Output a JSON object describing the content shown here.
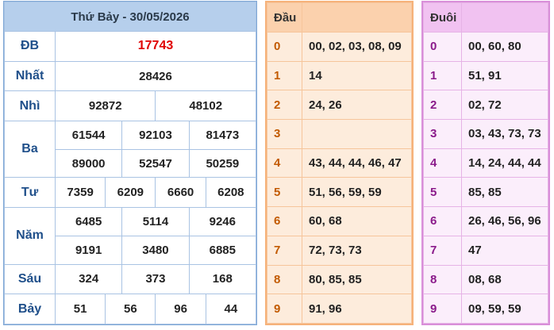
{
  "results": {
    "title": "Thứ Bảy - 30/05/2026",
    "rows": {
      "db": {
        "label": "ĐB",
        "values": [
          "17743"
        ]
      },
      "nhat": {
        "label": "Nhất",
        "values": [
          "28426"
        ]
      },
      "nhi": {
        "label": "Nhì",
        "values": [
          "92872",
          "48102"
        ]
      },
      "ba": {
        "label": "Ba",
        "values": [
          "61544",
          "92103",
          "81473",
          "89000",
          "52547",
          "50259"
        ]
      },
      "tu": {
        "label": "Tư",
        "values": [
          "7359",
          "6209",
          "6660",
          "6208"
        ]
      },
      "nam": {
        "label": "Năm",
        "values": [
          "6485",
          "5114",
          "9246",
          "9191",
          "3480",
          "6885"
        ]
      },
      "sau": {
        "label": "Sáu",
        "values": [
          "324",
          "373",
          "168"
        ]
      },
      "bay": {
        "label": "Bảy",
        "values": [
          "51",
          "56",
          "96",
          "44"
        ]
      }
    },
    "special_color": "#e00000"
  },
  "dau": {
    "header": "Đầu",
    "rows": [
      {
        "k": "0",
        "v": "00, 02, 03, 08, 09"
      },
      {
        "k": "1",
        "v": "14"
      },
      {
        "k": "2",
        "v": "24, 26"
      },
      {
        "k": "3",
        "v": ""
      },
      {
        "k": "4",
        "v": "43, 44, 44, 46, 47"
      },
      {
        "k": "5",
        "v": "51, 56, 59, 59"
      },
      {
        "k": "6",
        "v": "60, 68"
      },
      {
        "k": "7",
        "v": "72, 73, 73"
      },
      {
        "k": "8",
        "v": "80, 85, 85"
      },
      {
        "k": "9",
        "v": "91, 96"
      }
    ]
  },
  "duoi": {
    "header": "Đuôi",
    "rows": [
      {
        "k": "0",
        "v": "00, 60, 80"
      },
      {
        "k": "1",
        "v": "51, 91"
      },
      {
        "k": "2",
        "v": "02, 72"
      },
      {
        "k": "3",
        "v": "03, 43, 73, 73"
      },
      {
        "k": "4",
        "v": "14, 24, 44, 44"
      },
      {
        "k": "5",
        "v": "85, 85"
      },
      {
        "k": "6",
        "v": "26, 46, 56, 96"
      },
      {
        "k": "7",
        "v": "47"
      },
      {
        "k": "8",
        "v": "08, 68"
      },
      {
        "k": "9",
        "v": "09, 59, 59"
      }
    ]
  }
}
